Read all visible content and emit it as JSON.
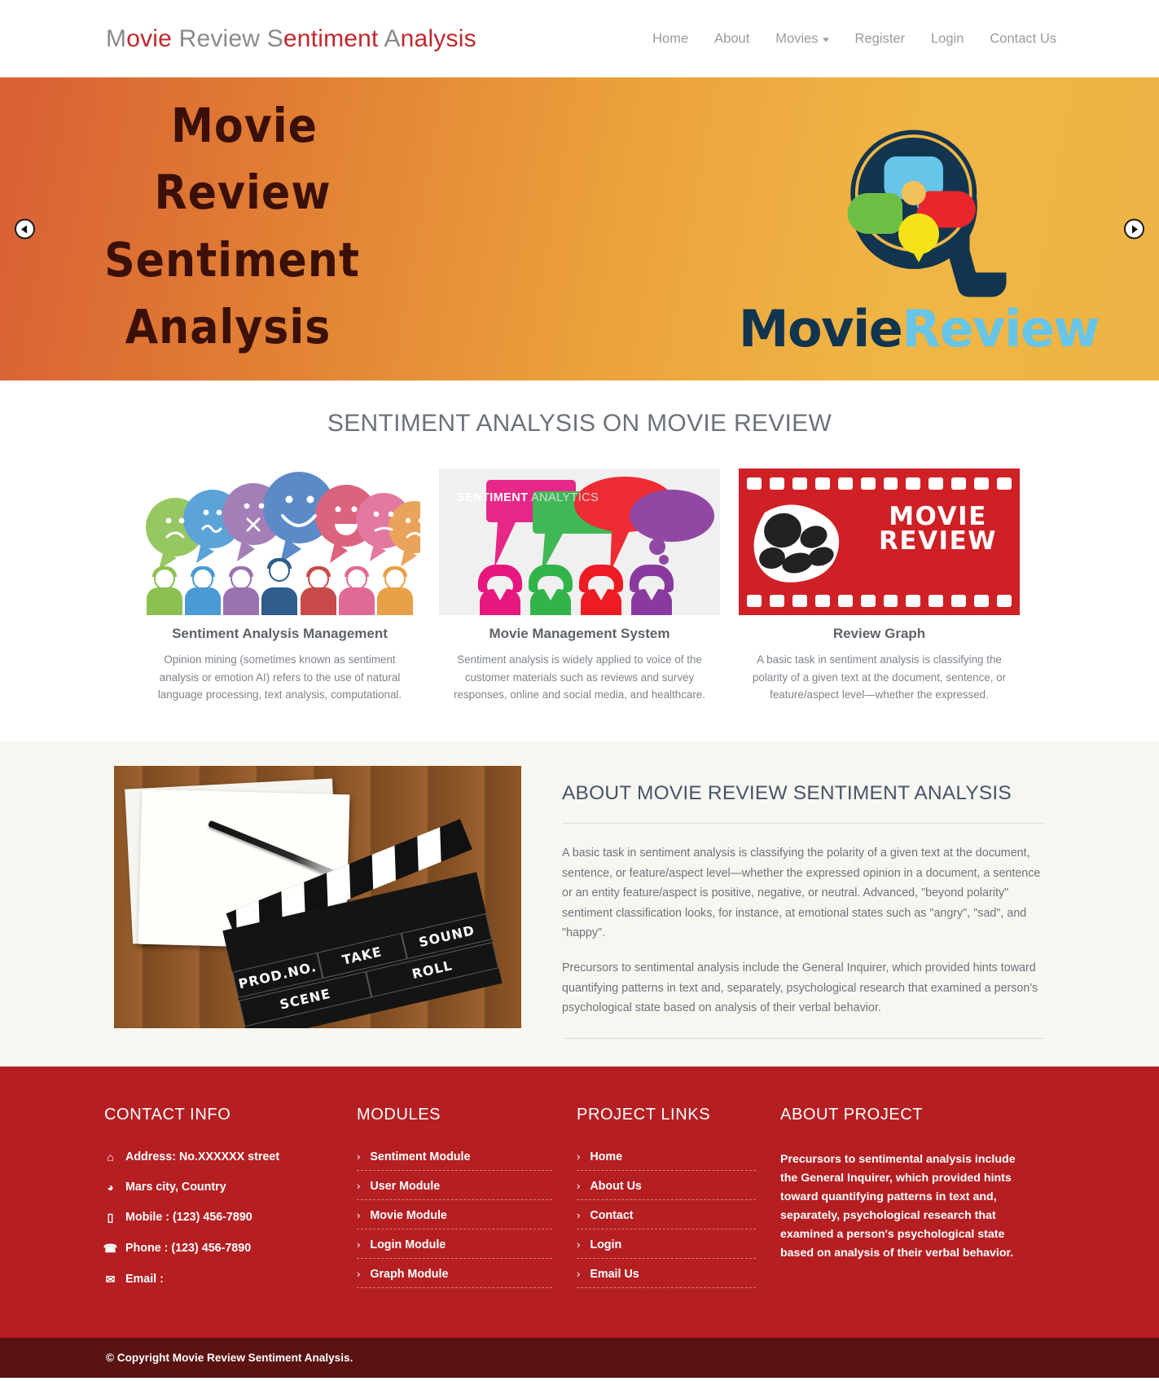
{
  "header": {
    "brand_parts": [
      {
        "initial": "M",
        "rest": "ovie "
      },
      {
        "initial": "R",
        "rest": "eview "
      },
      {
        "initial": "S",
        "rest": "entiment "
      },
      {
        "initial": "A",
        "rest": "nalysis"
      }
    ],
    "brand_full": "Movie Review Sentiment Analysis",
    "nav": [
      {
        "label": "Home",
        "has_caret": false
      },
      {
        "label": "About",
        "has_caret": false
      },
      {
        "label": "Movies",
        "has_caret": true
      },
      {
        "label": "Register",
        "has_caret": false
      },
      {
        "label": "Login",
        "has_caret": false
      },
      {
        "label": "Contact Us",
        "has_caret": false
      }
    ]
  },
  "hero": {
    "lines": [
      "Movie",
      "Review",
      "Sentiment",
      "Analysis"
    ],
    "logo_word_navy": "Movie",
    "logo_word_sky": "Review",
    "prev_label": "previous slide",
    "next_label": "next slide",
    "colors": {
      "gradient_start": "#d95f35",
      "gradient_end": "#edb445",
      "title": "#3a1008",
      "logo_navy": "#12354f",
      "logo_sky": "#66c5e8"
    }
  },
  "services": {
    "title": "SENTIMENT ANALYSIS ON MOVIE REVIEW",
    "cards": [
      {
        "title": "Sentiment Analysis Management",
        "text": "Opinion mining (sometimes known as sentiment analysis or emotion AI) refers to the use of natural language processing, text analysis, computational."
      },
      {
        "title": "Movie Management System",
        "text": "Sentiment analysis is widely applied to voice of the customer materials such as reviews and survey responses, online and social media, and healthcare.",
        "graphic_label_bold": "SENTIMENT",
        "graphic_label_light": " ANALYTICS"
      },
      {
        "title": "Review Graph",
        "text": "A basic task in sentiment analysis is classifying the polarity of a given text at the document, sentence, or feature/aspect level—whether the expressed.",
        "graphic_text_line1": "MOVIE",
        "graphic_text_line2": "REVIEW"
      }
    ]
  },
  "about": {
    "heading": "ABOUT MOVIE REVIEW SENTIMENT ANALYSIS",
    "paragraphs": [
      "A basic task in sentiment analysis is classifying the polarity of a given text at the document, sentence, or feature/aspect level—whether the expressed opinion in a document, a sentence or an entity feature/aspect is positive, negative, or neutral. Advanced, \"beyond polarity\" sentiment classification looks, for instance, at emotional states such as \"angry\", \"sad\", and \"happy\".",
      "Precursors to sentimental analysis include the General Inquirer, which provided hints toward quantifying patterns in text and, separately, psychological research that examined a person's psychological state based on analysis of their verbal behavior."
    ],
    "photo_clapper": {
      "prodno": "PROD.NO.",
      "take": "TAKE",
      "sound": "SOUND",
      "scene": "SCENE",
      "roll": "ROLL"
    }
  },
  "footer": {
    "contact": {
      "heading": "CONTACT INFO",
      "items": [
        {
          "icon": "home-icon",
          "glyph": "⌂",
          "text": "Address: No.XXXXXX street"
        },
        {
          "icon": "globe-icon",
          "glyph": "◕",
          "text": "Mars city, Country"
        },
        {
          "icon": "mobile-icon",
          "glyph": "▯",
          "text": "Mobile : (123) 456-7890"
        },
        {
          "icon": "phone-icon",
          "glyph": "☎",
          "text": "Phone : (123) 456-7890"
        },
        {
          "icon": "envelope-icon",
          "glyph": "✉",
          "text": "Email :"
        }
      ]
    },
    "modules": {
      "heading": "MODULES",
      "items": [
        "Sentiment Module",
        "User Module",
        "Movie Module",
        "Login Module",
        "Graph Module"
      ]
    },
    "links": {
      "heading": "PROJECT LINKS",
      "items": [
        "Home",
        "About Us",
        "Contact",
        "Login",
        "Email Us"
      ]
    },
    "about_project": {
      "heading": "ABOUT PROJECT",
      "text": "Precursors to sentimental analysis include the General Inquirer, which provided hints toward quantifying patterns in text and, separately, psychological research that examined a person's psychological state based on analysis of their verbal behavior."
    },
    "chevron": "›",
    "copyright": "© Copyright Movie Review Sentiment Analysis.",
    "colors": {
      "bg": "#b51f22",
      "copyright_bg": "#5b1212"
    }
  }
}
